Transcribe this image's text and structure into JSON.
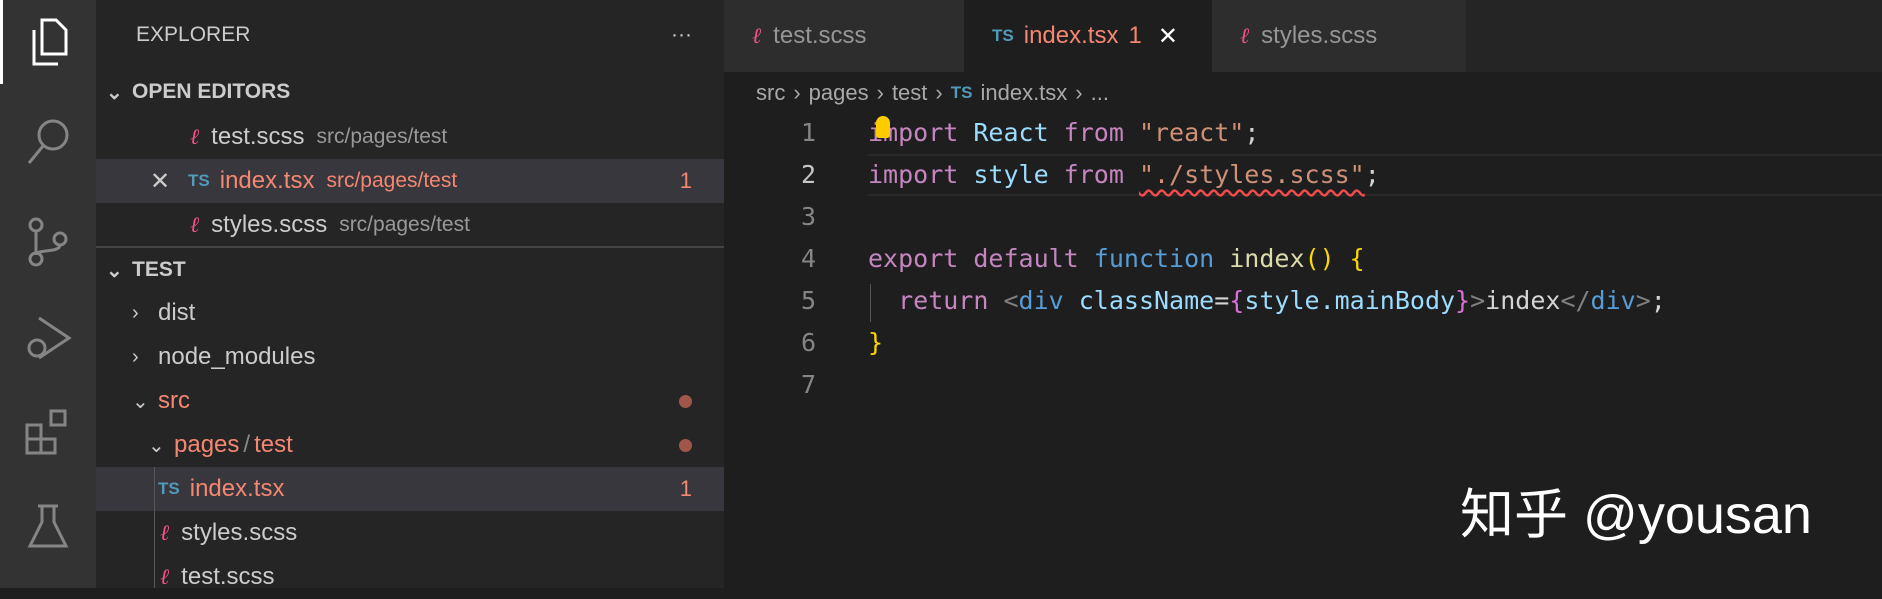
{
  "sidebar": {
    "title": "EXPLORER",
    "more": "···",
    "open_editors": {
      "header": "OPEN EDITORS",
      "items": [
        {
          "icon": "sass-icon",
          "name": "test.scss",
          "path": "src/pages/test"
        },
        {
          "icon": "ts-icon",
          "name": "index.tsx",
          "path": "src/pages/test",
          "badge": "1",
          "close": "✕"
        },
        {
          "icon": "sass-icon",
          "name": "styles.scss",
          "path": "src/pages/test"
        }
      ]
    },
    "project": {
      "header": "TEST",
      "items": [
        {
          "name": "dist"
        },
        {
          "name": "node_modules"
        },
        {
          "name": "src"
        },
        {
          "name": "pages",
          "name2": "test",
          "sep": "/"
        },
        {
          "name": "index.tsx",
          "badge": "1"
        },
        {
          "name": "styles.scss"
        },
        {
          "name": "test.scss"
        }
      ]
    }
  },
  "tabs": [
    {
      "label": "test.scss"
    },
    {
      "label": "index.tsx",
      "badge": "1",
      "close": "✕"
    },
    {
      "label": "styles.scss"
    }
  ],
  "ts_label": "TS",
  "breadcrumb": [
    "src",
    "pages",
    "test",
    "index.tsx",
    "..."
  ],
  "code": {
    "line_numbers": [
      "1",
      "2",
      "3",
      "4",
      "5",
      "6",
      "7"
    ],
    "l1": [
      "import",
      " React",
      " from",
      " \"react\"",
      ";"
    ],
    "l2": [
      "import",
      " style",
      " from",
      " ",
      "\"./styles.scss\"",
      ";"
    ],
    "l4": [
      "export",
      " default",
      " function",
      " index",
      "()",
      " {"
    ],
    "l5": [
      "  return ",
      "<",
      "div",
      " className",
      "=",
      "{",
      "style.mainBody",
      "}",
      ">",
      "index",
      "</",
      "div",
      ">",
      ";"
    ],
    "l6": "}"
  },
  "watermark": "知乎 @yousan"
}
